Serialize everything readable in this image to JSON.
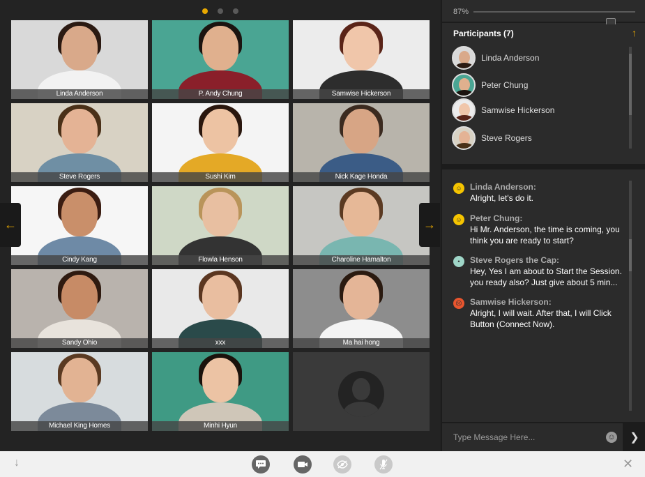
{
  "page_indicator": {
    "count": 3,
    "active": 0
  },
  "tiles": [
    {
      "name": "Linda Anderson",
      "bg": "#d9d9d9",
      "skin": "#d9a98a",
      "hair": "#2b1a12",
      "shirt": "#f2f2f2",
      "selected": false
    },
    {
      "name": "P. Andy Chung",
      "bg": "#4aa593",
      "skin": "#e0b08e",
      "hair": "#1b1410",
      "shirt": "#8a1f2a",
      "selected": false
    },
    {
      "name": "Samwise Hickerson",
      "bg": "#ececec",
      "skin": "#f0c6aa",
      "hair": "#5a2418",
      "shirt": "#2d2d2d",
      "selected": false
    },
    {
      "name": "Steve Rogers",
      "bg": "#d8d2c4",
      "skin": "#e4b395",
      "hair": "#4a3018",
      "shirt": "#6f8fa4",
      "selected": true
    },
    {
      "name": "Sushi  Kim",
      "bg": "#f4f4f4",
      "skin": "#edc3a3",
      "hair": "#2a170e",
      "shirt": "#e4a926",
      "selected": false
    },
    {
      "name": "Nick Kage Honda",
      "bg": "#b8b4ab",
      "skin": "#d7a585",
      "hair": "#3b2a1f",
      "shirt": "#3b5c86",
      "selected": false
    },
    {
      "name": "Cindy Kang",
      "bg": "#f6f6f6",
      "skin": "#c98f6a",
      "hair": "#3b1d12",
      "shirt": "#6e8aa6",
      "selected": false
    },
    {
      "name": "Flowla Henson",
      "bg": "#cfd8c6",
      "skin": "#e8bfa1",
      "hair": "#b9945a",
      "shirt": "#333333",
      "selected": false
    },
    {
      "name": "Charoline Hamalton",
      "bg": "#c6c6c2",
      "skin": "#e6b897",
      "hair": "#5b3a22",
      "shirt": "#79b6b0",
      "selected": false
    },
    {
      "name": "Sandy Ohio",
      "bg": "#b9b3ad",
      "skin": "#c78b66",
      "hair": "#2e1a10",
      "shirt": "#e8e3dc",
      "selected": false
    },
    {
      "name": "xxx",
      "bg": "#e9e9e9",
      "skin": "#e9bea0",
      "hair": "#5a3620",
      "shirt": "#2a4a4a",
      "selected": false
    },
    {
      "name": "Ma hai hong",
      "bg": "#8d8d8d",
      "skin": "#e4b597",
      "hair": "#2a1a10",
      "shirt": "#f4f4f4",
      "selected": false
    },
    {
      "name": "Michael King Homes",
      "bg": "#d7dcde",
      "skin": "#e2b393",
      "hair": "#5a3a22",
      "shirt": "#7c8a9a",
      "selected": false
    },
    {
      "name": "Minhi Hyun",
      "bg": "#3f9a84",
      "skin": "#ecc3a4",
      "hair": "#1a120c",
      "shirt": "#cfc6b8",
      "selected": false
    }
  ],
  "zoom": {
    "value": "87%",
    "level": 0.87
  },
  "participants": {
    "title": "Participants (7)",
    "items": [
      {
        "name": "Linda Anderson",
        "skin": "#d9a98a",
        "hair": "#2b1a12",
        "bg": "#d9d9d9"
      },
      {
        "name": "Peter Chung",
        "skin": "#e0b08e",
        "hair": "#1b1410",
        "bg": "#4aa593"
      },
      {
        "name": "Samwise Hickerson",
        "skin": "#f0c6aa",
        "hair": "#5a2418",
        "bg": "#ececec"
      },
      {
        "name": "Steve Rogers",
        "skin": "#e4b395",
        "hair": "#4a3018",
        "bg": "#d8d2c4"
      }
    ]
  },
  "chat": {
    "messages": [
      {
        "sender": "Linda Anderson:",
        "text": "Alright, let's do it.",
        "emoji": "smile-emoji",
        "emoji_color": "#f5c400"
      },
      {
        "sender": "Peter Chung:",
        "text": "Hi Mr. Anderson, the time is coming, you think you are ready to start?",
        "emoji": "smile-emoji",
        "emoji_color": "#f5c400"
      },
      {
        "sender": "Steve Rogers the Cap:",
        "text": "Hey, Yes I am about to Start the Session. you ready also? Just give about 5 min...",
        "emoji": "neutral-emoji",
        "emoji_color": "#9fd6c8"
      },
      {
        "sender": "Samwise Hickerson:",
        "text": "Alright, I will wait. After that, I will Click Button (Connect Now).",
        "emoji": "angry-emoji",
        "emoji_color": "#e8552e"
      }
    ],
    "input_placeholder": "Type Message Here..."
  },
  "colors": {
    "accent": "#e8a800",
    "selected_border": "#f5c400",
    "bg_dark": "#232323"
  }
}
